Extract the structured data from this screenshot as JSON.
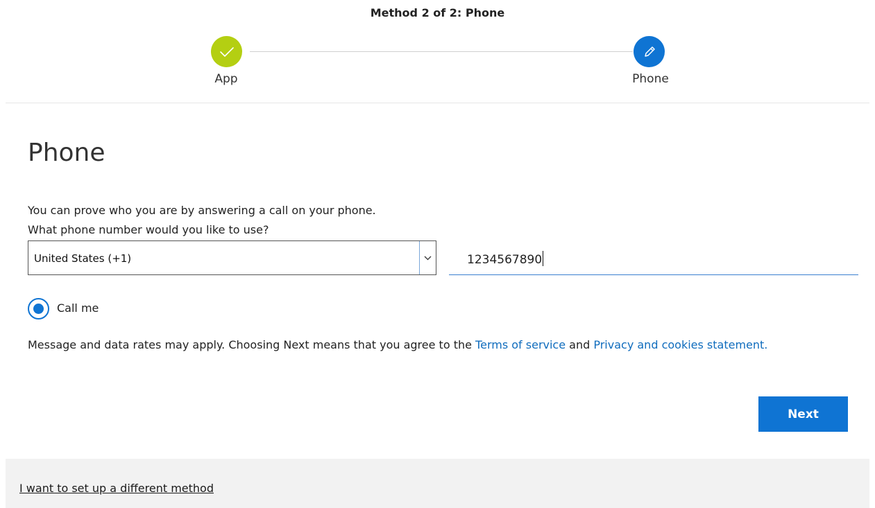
{
  "header": {
    "method_title": "Method 2 of 2: Phone"
  },
  "steps": [
    {
      "label": "App",
      "state": "complete",
      "icon": "check-icon",
      "color": "#b4cf12"
    },
    {
      "label": "Phone",
      "state": "current",
      "icon": "pencil-icon",
      "color": "#0f74d3"
    }
  ],
  "main": {
    "title": "Phone",
    "description_line1": "You can prove who you are by answering a call on your phone.",
    "description_line2": "What phone number would you like to use?",
    "country_select": {
      "value": "United States (+1)",
      "icon": "chevron-down-icon"
    },
    "phone_input": {
      "value": "1234567890"
    },
    "radio": {
      "label": "Call me",
      "checked": true
    },
    "terms": {
      "text_before": "Message and data rates may apply. Choosing Next means that you agree to the ",
      "terms_link": "Terms of service",
      "text_middle": " and ",
      "privacy_link": "Privacy and cookies statement."
    },
    "next_button": "Next"
  },
  "footer": {
    "link": "I want to set up a different method"
  },
  "colors": {
    "accent": "#0f74d3",
    "success": "#b4cf12",
    "link": "#0f6cbd",
    "footer_bg": "#f2f2f2"
  }
}
